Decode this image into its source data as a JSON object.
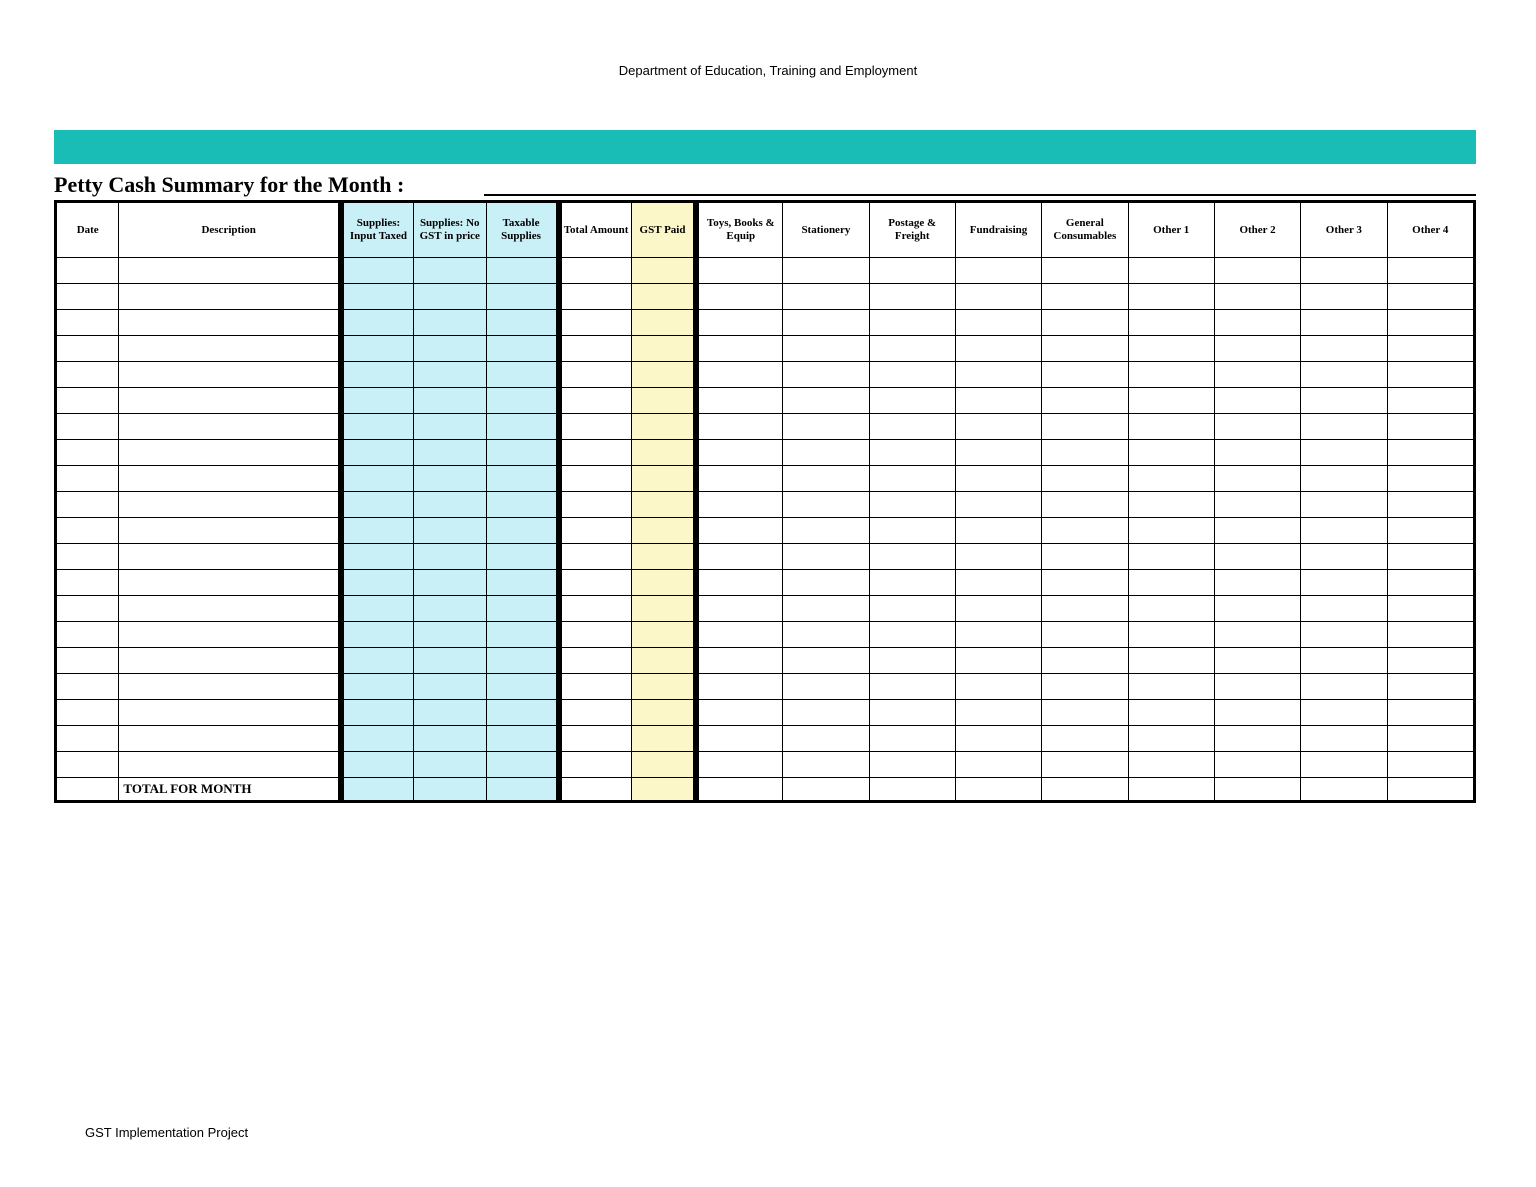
{
  "header": {
    "org": "Department of Education, Training and Employment"
  },
  "title": "Petty Cash Summary for the Month :",
  "columns": [
    "Date",
    "Description",
    "Supplies: Input Taxed",
    "Supplies: No GST in price",
    "Taxable Supplies",
    "Total Amount",
    "GST Paid",
    "Toys, Books & Equip",
    "Stationery",
    "Postage & Freight",
    "Fundraising",
    "General Consumables",
    "Other 1",
    "Other 2",
    "Other 3",
    "Other 4"
  ],
  "total_label": "TOTAL FOR MONTH",
  "row_count": 20,
  "footer": "GST Implementation Project"
}
